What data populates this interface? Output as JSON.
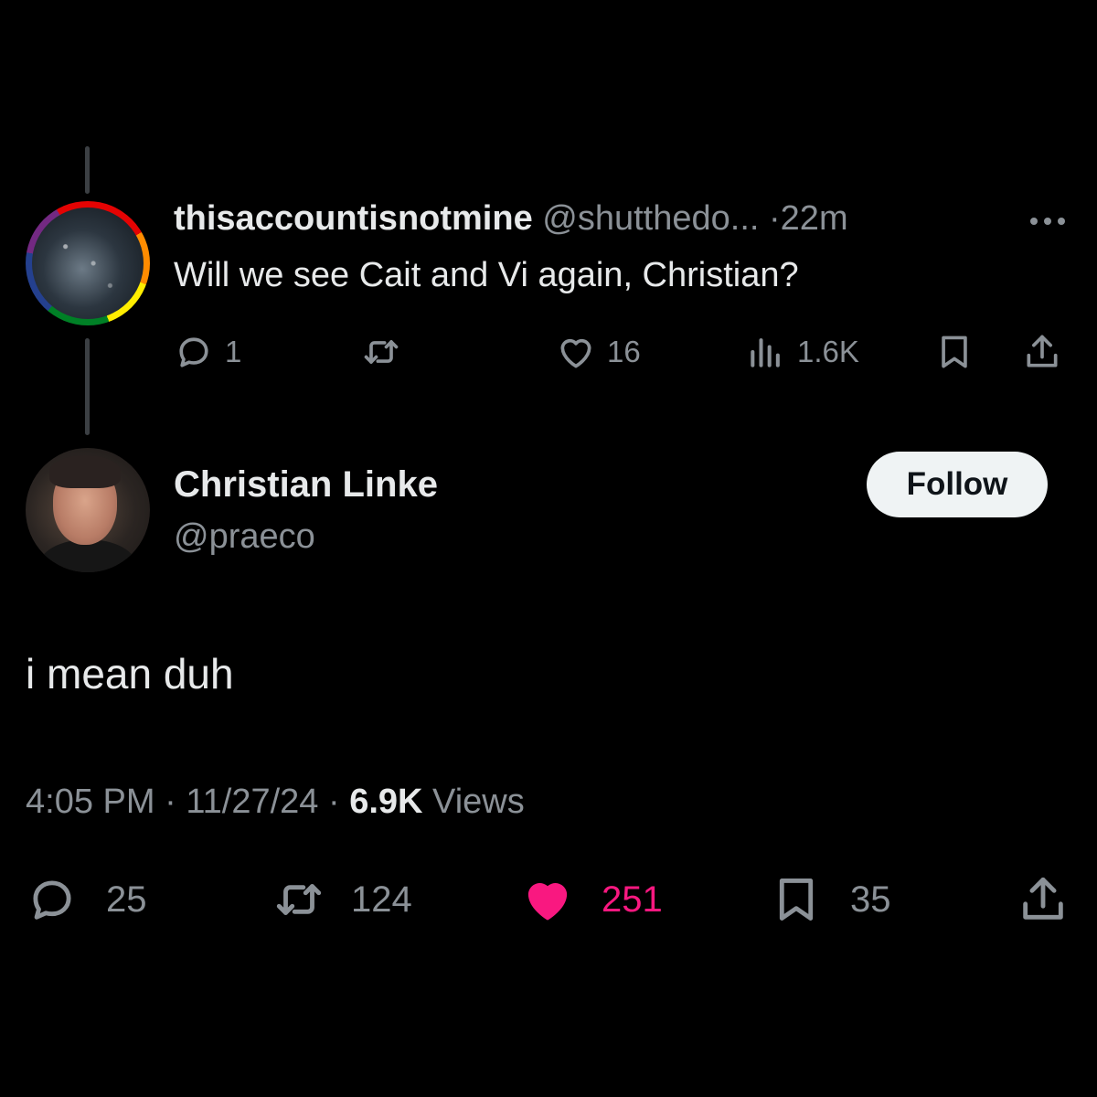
{
  "parent_tweet": {
    "display_name": "thisaccountisnotmine",
    "handle": "@shutthedo...",
    "separator": "·",
    "time": "22m",
    "text": "Will we see Cait and Vi again, Christian?",
    "avatar_ring": "rainbow",
    "actions": {
      "reply_count": "1",
      "like_count": "16",
      "views_count": "1.6K"
    }
  },
  "main_tweet": {
    "display_name": "Christian Linke",
    "handle": "@praeco",
    "follow_label": "Follow",
    "text": "i mean duh",
    "meta": {
      "time": "4:05 PM",
      "sep1": "·",
      "date": "11/27/24",
      "sep2": "·",
      "views_count": "6.9K",
      "views_label": "Views"
    },
    "actions": {
      "reply_count": "25",
      "retweet_count": "124",
      "like_count": "251",
      "bookmark_count": "35",
      "liked": true
    }
  },
  "colors": {
    "background": "#000000",
    "text_primary": "#e7e9ea",
    "text_muted": "#8b9197",
    "like_pink": "#f91880",
    "follow_bg": "#eff3f4"
  },
  "icons": [
    "more-icon",
    "reply-icon",
    "retweet-icon",
    "like-icon",
    "views-icon",
    "bookmark-icon",
    "share-icon"
  ]
}
